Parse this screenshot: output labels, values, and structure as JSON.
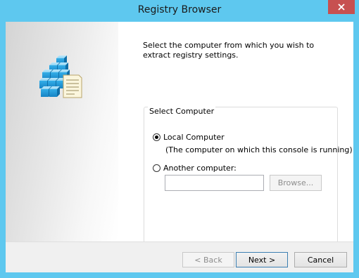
{
  "window": {
    "title": "Registry Browser"
  },
  "main": {
    "instructions": "Select the computer from which you wish to extract registry settings.",
    "group_label": "Select Computer",
    "local_option": {
      "label": "Local Computer",
      "note": "(The computer on which this console is running)",
      "selected": true
    },
    "another_option": {
      "label": "Another computer:",
      "selected": false,
      "input_value": ""
    },
    "browse_label": "Browse..."
  },
  "footer": {
    "back_label": "< Back",
    "next_label": "Next >",
    "cancel_label": "Cancel"
  },
  "icons": {
    "close": "close-icon",
    "registry": "registry-icon"
  },
  "colors": {
    "title_bar": "#5ec8ef",
    "close_button": "#c75050",
    "default_button_border": "#3c7fb1"
  }
}
